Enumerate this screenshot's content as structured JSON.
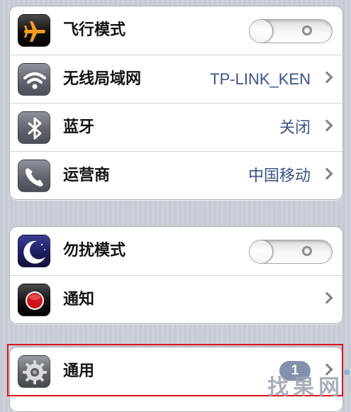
{
  "groups": [
    {
      "rows": [
        {
          "label": "飞行模式",
          "icon": "airplane-icon",
          "control": "toggle",
          "toggle_on": false
        },
        {
          "label": "无线局域网",
          "icon": "wifi-icon",
          "value": "TP-LINK_KEN"
        },
        {
          "label": "蓝牙",
          "icon": "bluetooth-icon",
          "value": "关闭"
        },
        {
          "label": "运营商",
          "icon": "phone-icon",
          "value": "中国移动"
        }
      ]
    },
    {
      "rows": [
        {
          "label": "勿扰模式",
          "icon": "moon-icon",
          "control": "toggle",
          "toggle_on": false
        },
        {
          "label": "通知",
          "icon": "notification-icon"
        }
      ]
    },
    {
      "rows": [
        {
          "label": "通用",
          "icon": "gear-icon",
          "badge": "1"
        }
      ]
    }
  ],
  "watermark": "找果网",
  "colors": {
    "value_text": "#385487",
    "highlight_border": "#e2111c",
    "badge": "#8391ad"
  }
}
